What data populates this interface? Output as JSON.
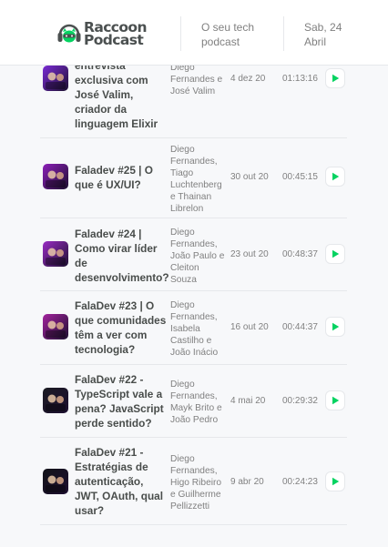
{
  "header": {
    "logo_text": "Raccoon Podcast",
    "logo_line1": "Raccoon",
    "logo_line2": "Podcast",
    "tagline_line1": "O seu tech",
    "tagline_line2": "podcast",
    "date_line1": "Sab, 24",
    "date_line2": "Abril"
  },
  "colors": {
    "accent": "#04d361",
    "text": "#494d4b",
    "muted": "#808080",
    "border": "#e6e8eb",
    "background": "#f7f8fa"
  },
  "episodes": [
    {
      "title_lines": [
        "entrevista",
        "exclusiva com",
        "José Valim,",
        "criador da",
        "linguagem Elixir"
      ],
      "members_lines": [
        "Diego",
        "Fernandes e",
        "José Valim"
      ],
      "date": "4 dez 20",
      "duration": "01:13:16",
      "thumb_color": "#7a2bd4",
      "icon": "play-icon"
    },
    {
      "title_lines": [
        "Faladev #25 | O",
        "que é UX/UI?"
      ],
      "members_lines": [
        "Diego",
        "Fernandes,",
        "Tiago",
        "Luchtenberg",
        "e Thainan",
        "Librelon"
      ],
      "date": "30 out 20",
      "duration": "00:45:15",
      "thumb_color": "#8c1fb8",
      "icon": "play-icon"
    },
    {
      "title_lines": [
        "Faladev #24 |",
        "Como virar líder",
        "de",
        "desenvolvimento?"
      ],
      "members_lines": [
        "Diego",
        "Fernandes,",
        "João Paulo e",
        "Cleiton",
        "Souza"
      ],
      "date": "23 out 20",
      "duration": "00:48:37",
      "thumb_color": "#9a2cc4",
      "icon": "play-icon"
    },
    {
      "title_lines": [
        "FalaDev #23 | O",
        "que comunidades",
        "têm a ver com",
        "tecnologia?"
      ],
      "members_lines": [
        "Diego",
        "Fernandes,",
        "Isabela",
        "Castilho e",
        "João Inácio"
      ],
      "date": "16 out 20",
      "duration": "00:44:37",
      "thumb_color": "#a3239e",
      "icon": "play-icon"
    },
    {
      "title_lines": [
        "FalaDev #22 -",
        "TypeScript vale a",
        "pena? JavaScript",
        "perde sentido?"
      ],
      "members_lines": [
        "Diego",
        "Fernandes,",
        "Mayk Brito e",
        "João Pedro"
      ],
      "date": "4 mai 20",
      "duration": "00:29:32",
      "thumb_color": "#1b1b22",
      "icon": "play-icon"
    },
    {
      "title_lines": [
        "FalaDev #21 -",
        "Estratégias de",
        "autenticação,",
        "JWT, OAuth, qual",
        "usar?"
      ],
      "members_lines": [
        "Diego",
        "Fernandes,",
        "Higo Ribeiro",
        "e Guilherme",
        "Pellizzetti"
      ],
      "date": "9 abr 20",
      "duration": "00:24:23",
      "thumb_color": "#121218",
      "icon": "play-icon"
    }
  ]
}
